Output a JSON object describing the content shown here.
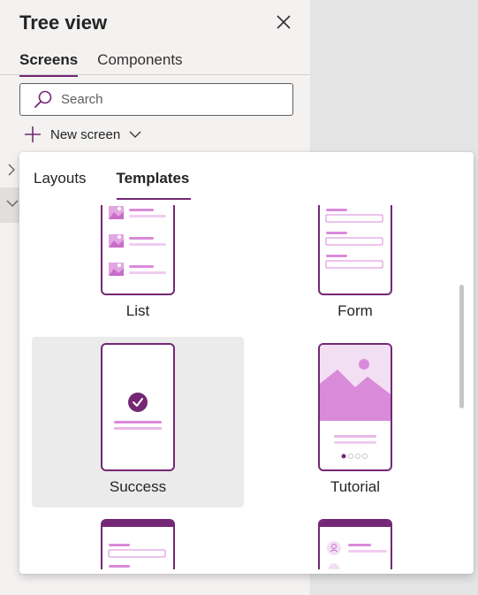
{
  "tree_view": {
    "title": "Tree view",
    "tabs": [
      {
        "label": "Screens",
        "active": true
      },
      {
        "label": "Components",
        "active": false
      }
    ],
    "search": {
      "placeholder": "Search",
      "value": ""
    },
    "new_screen_label": "New screen"
  },
  "popup": {
    "tabs": [
      {
        "label": "Layouts",
        "active": false
      },
      {
        "label": "Templates",
        "active": true
      }
    ],
    "templates": [
      {
        "label": "List",
        "icon": "list-template-icon"
      },
      {
        "label": "Form",
        "icon": "form-template-icon"
      },
      {
        "label": "Success",
        "icon": "success-template-icon",
        "selected": true
      },
      {
        "label": "Tutorial",
        "icon": "tutorial-template-icon"
      },
      {
        "label": "",
        "icon": "form-template-icon"
      },
      {
        "label": "",
        "icon": "contact-template-icon"
      }
    ]
  },
  "colors": {
    "accent": "#742774",
    "accent_light": "#d98ad9",
    "tint": "#f3dff3",
    "selected_bg": "#ebebeb"
  }
}
